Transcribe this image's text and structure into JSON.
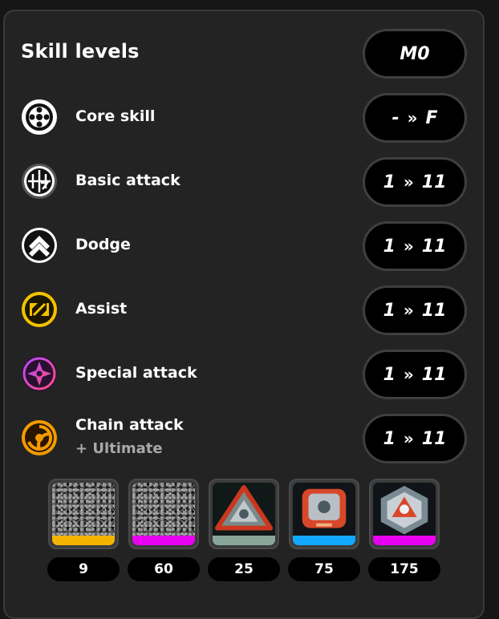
{
  "panel": {
    "title": "Skill levels",
    "mindscape": "M0"
  },
  "skills": [
    {
      "label": "Core skill",
      "sub": "",
      "from": "-",
      "to": "F",
      "icon": "core-skill-icon"
    },
    {
      "label": "Basic attack",
      "sub": "",
      "from": "1",
      "to": "11",
      "icon": "basic-attack-icon"
    },
    {
      "label": "Dodge",
      "sub": "",
      "from": "1",
      "to": "11",
      "icon": "dodge-icon"
    },
    {
      "label": "Assist",
      "sub": "",
      "from": "1",
      "to": "11",
      "icon": "assist-icon"
    },
    {
      "label": "Special attack",
      "sub": "",
      "from": "1",
      "to": "11",
      "icon": "special-attack-icon"
    },
    {
      "label": "Chain attack",
      "sub": "+ Ultimate",
      "from": "1",
      "to": "11",
      "icon": "chain-attack-icon"
    }
  ],
  "arrow_glyph": "»",
  "materials": [
    {
      "count": "9",
      "rarity_color": "#f5b400",
      "icon": "unknown-material-icon"
    },
    {
      "count": "60",
      "rarity_color": "#e800f0",
      "icon": "unknown-material-icon"
    },
    {
      "count": "25",
      "rarity_color": "#8aa69a",
      "icon": "skill-chip-triangle-icon"
    },
    {
      "count": "75",
      "rarity_color": "#12a8ff",
      "icon": "skill-chip-square-icon"
    },
    {
      "count": "175",
      "rarity_color": "#e800f0",
      "icon": "skill-chip-hexagon-icon"
    }
  ]
}
